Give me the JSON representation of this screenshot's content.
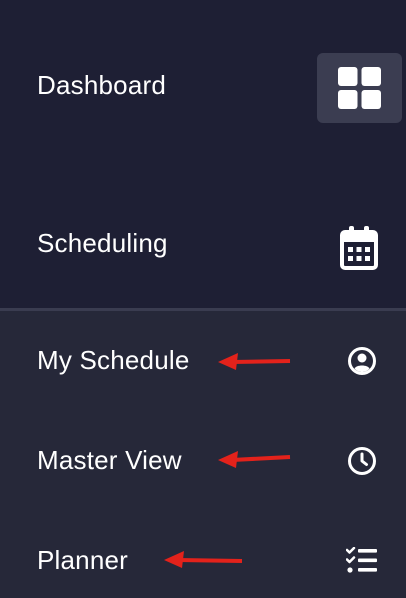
{
  "nav": {
    "dashboard": {
      "label": "Dashboard",
      "icon": "grid-icon"
    },
    "scheduling": {
      "label": "Scheduling",
      "icon": "calendar-icon"
    },
    "submenu": [
      {
        "label": "My Schedule",
        "icon": "user-circle-icon"
      },
      {
        "label": "Master View",
        "icon": "clock-icon"
      },
      {
        "label": "Planner",
        "icon": "checklist-icon"
      }
    ]
  },
  "colors": {
    "background": "#1e1f34",
    "submenu_background": "#262839",
    "active_icon_bg": "#3b3d51",
    "text": "#ffffff",
    "annotation_arrow": "#e3221b"
  }
}
